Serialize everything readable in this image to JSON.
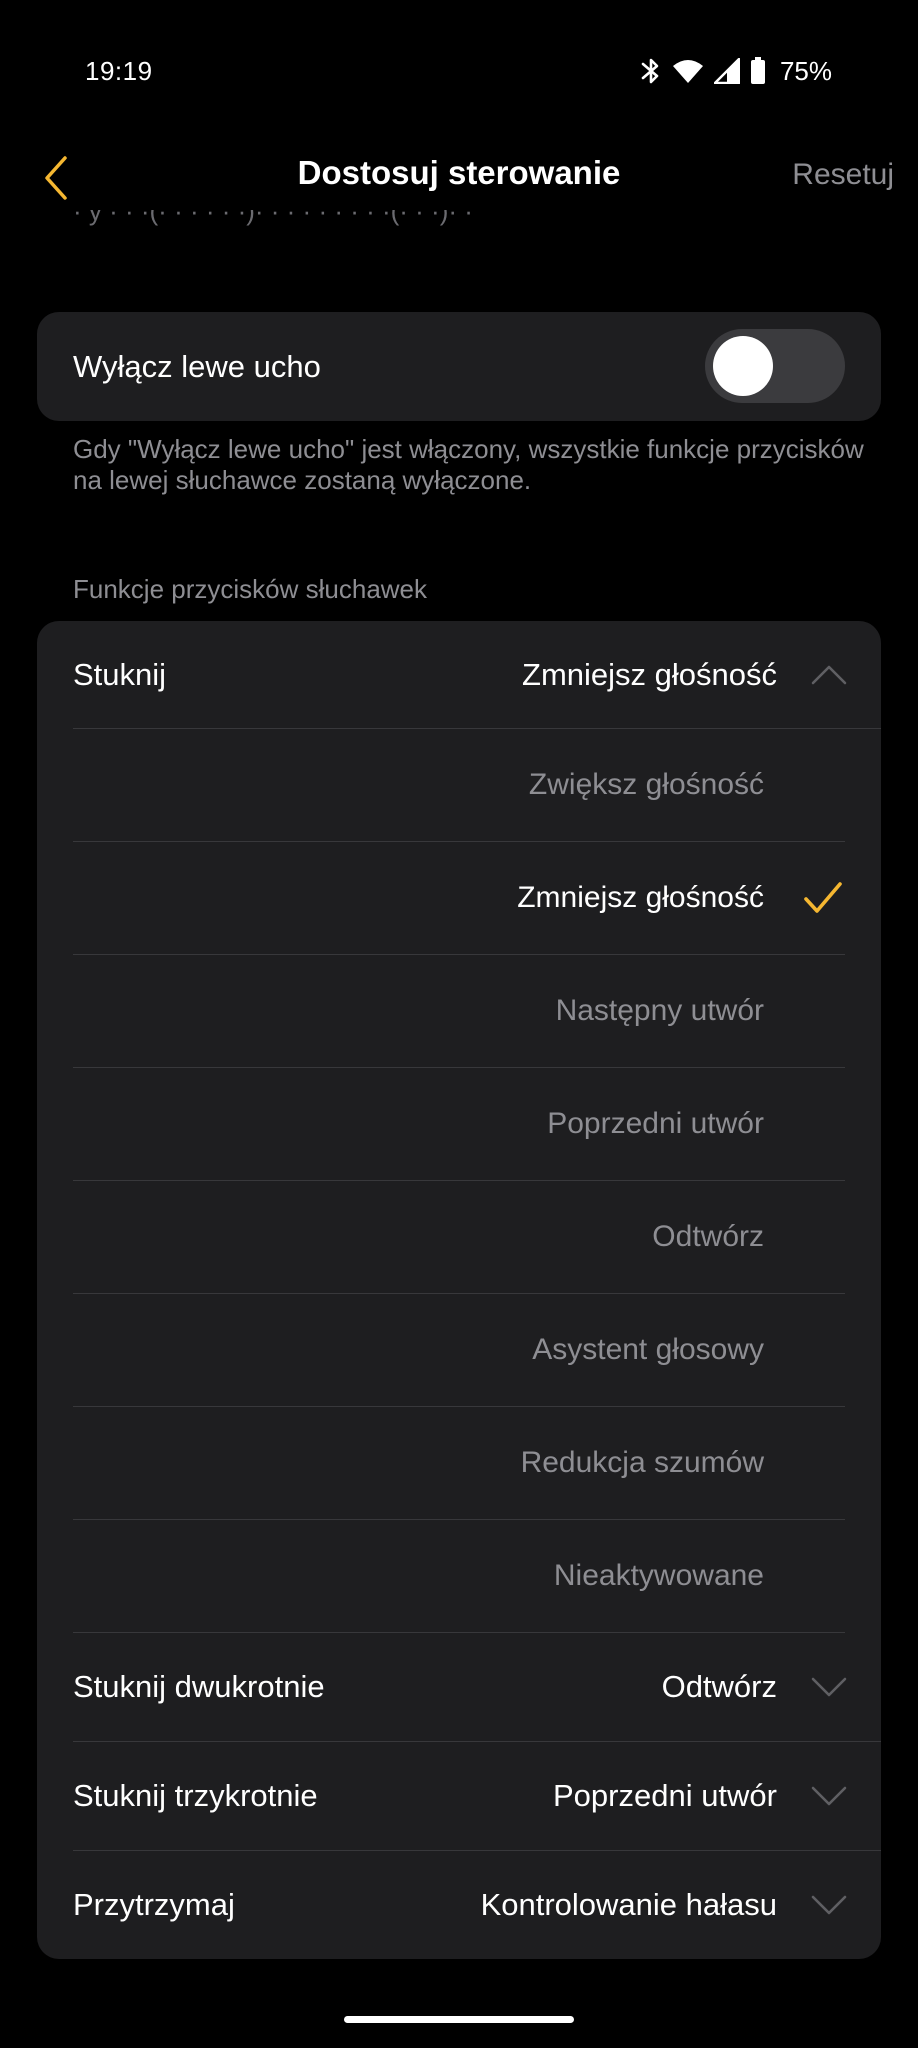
{
  "status_bar": {
    "time": "19:19",
    "battery": "75%",
    "icons": [
      "bluetooth-icon",
      "wifi-icon",
      "signal-icon",
      "battery-icon"
    ]
  },
  "header": {
    "title": "Dostosuj sterowanie",
    "reset_label": "Resetuj",
    "back_icon": "chevron-left-icon"
  },
  "toggle": {
    "label": "Wyłącz lewe ucho",
    "enabled": false,
    "description": "Gdy \"Wyłącz lewe ucho\" jest włączony, wszystkie funkcje przycisków na lewej słuchawce zostaną wyłączone."
  },
  "functions": {
    "section_title": "Funkcje przycisków słuchawek",
    "rows": [
      {
        "label": "Stuknij",
        "value": "Zmniejsz głośność",
        "expanded": true
      },
      {
        "label": "Stuknij dwukrotnie",
        "value": "Odtwórz",
        "expanded": false
      },
      {
        "label": "Stuknij trzykrotnie",
        "value": "Poprzedni utwór",
        "expanded": false
      },
      {
        "label": "Przytrzymaj",
        "value": "Kontrolowanie hałasu",
        "expanded": false
      }
    ],
    "options": [
      {
        "label": "Zwiększ głośność",
        "selected": false
      },
      {
        "label": "Zmniejsz głośność",
        "selected": true
      },
      {
        "label": "Następny utwór",
        "selected": false
      },
      {
        "label": "Poprzedni utwór",
        "selected": false
      },
      {
        "label": "Odtwórz",
        "selected": false
      },
      {
        "label": "Asystent głosowy",
        "selected": false
      },
      {
        "label": "Redukcja szumów",
        "selected": false
      },
      {
        "label": "Nieaktywowane",
        "selected": false
      }
    ]
  },
  "colors": {
    "background": "#000000",
    "card": "#1e1e20",
    "accent": "#f5b731",
    "secondary_text": "#8e8e93",
    "divider": "#38383b"
  }
}
